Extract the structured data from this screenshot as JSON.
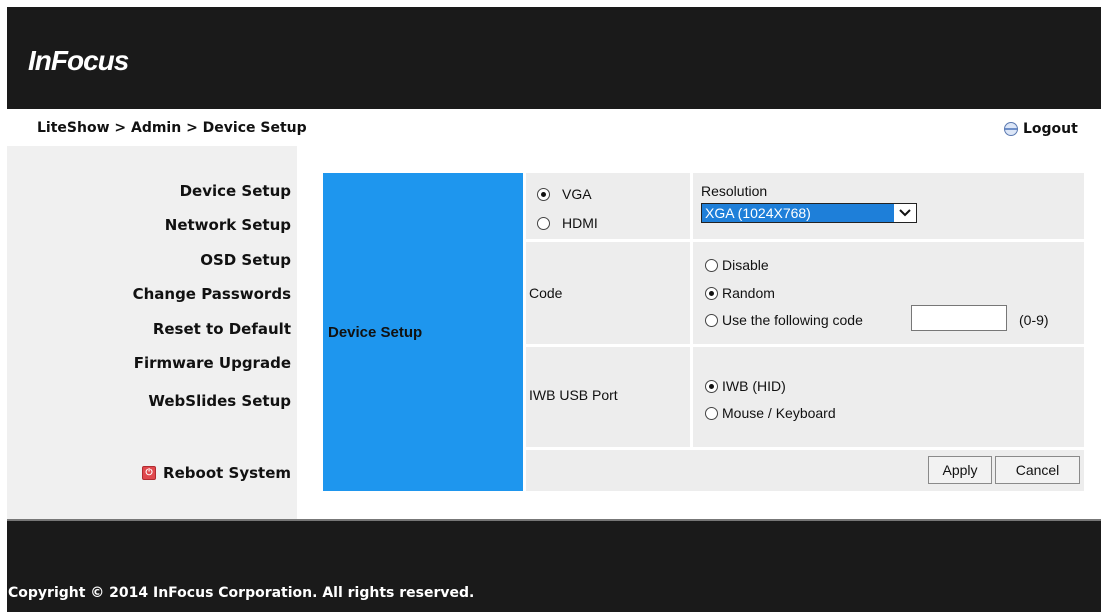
{
  "header": {
    "logo_text": "InFocus"
  },
  "breadcrumb": "LiteShow > Admin > Device Setup",
  "logout": {
    "label": "Logout",
    "icon": "logout-icon"
  },
  "nav": {
    "items": [
      {
        "label": "Device Setup"
      },
      {
        "label": "Network Setup"
      },
      {
        "label": "OSD Setup"
      },
      {
        "label": "Change Passwords"
      },
      {
        "label": "Reset to Default"
      },
      {
        "label": "Firmware Upgrade"
      },
      {
        "label": "WebSlides Setup"
      }
    ],
    "reboot": {
      "label": "Reboot System",
      "icon": "power-icon"
    }
  },
  "section": {
    "title": "Device Setup"
  },
  "video": {
    "options": [
      {
        "label": "VGA",
        "checked": true
      },
      {
        "label": "HDMI",
        "checked": false
      }
    ]
  },
  "resolution": {
    "label": "Resolution",
    "value": "XGA (1024X768)"
  },
  "code": {
    "label": "Code",
    "options": [
      {
        "label": "Disable",
        "checked": false
      },
      {
        "label": "Random",
        "checked": true
      },
      {
        "label": "Use the following code",
        "checked": false
      }
    ],
    "input_value": "",
    "range_hint": "(0-9)"
  },
  "iwb": {
    "label": "IWB USB Port",
    "options": [
      {
        "label": "IWB (HID)",
        "checked": true
      },
      {
        "label": "Mouse / Keyboard",
        "checked": false
      }
    ]
  },
  "buttons": {
    "apply": "Apply",
    "cancel": "Cancel"
  },
  "footer": {
    "copyright": "Copyright © 2014 InFocus Corporation. All rights reserved."
  },
  "colors": {
    "header_bg": "#1a1a1a",
    "section_blue": "#1e96ee",
    "select_highlight": "#1e7fd9",
    "reboot_red": "#e0484d"
  }
}
